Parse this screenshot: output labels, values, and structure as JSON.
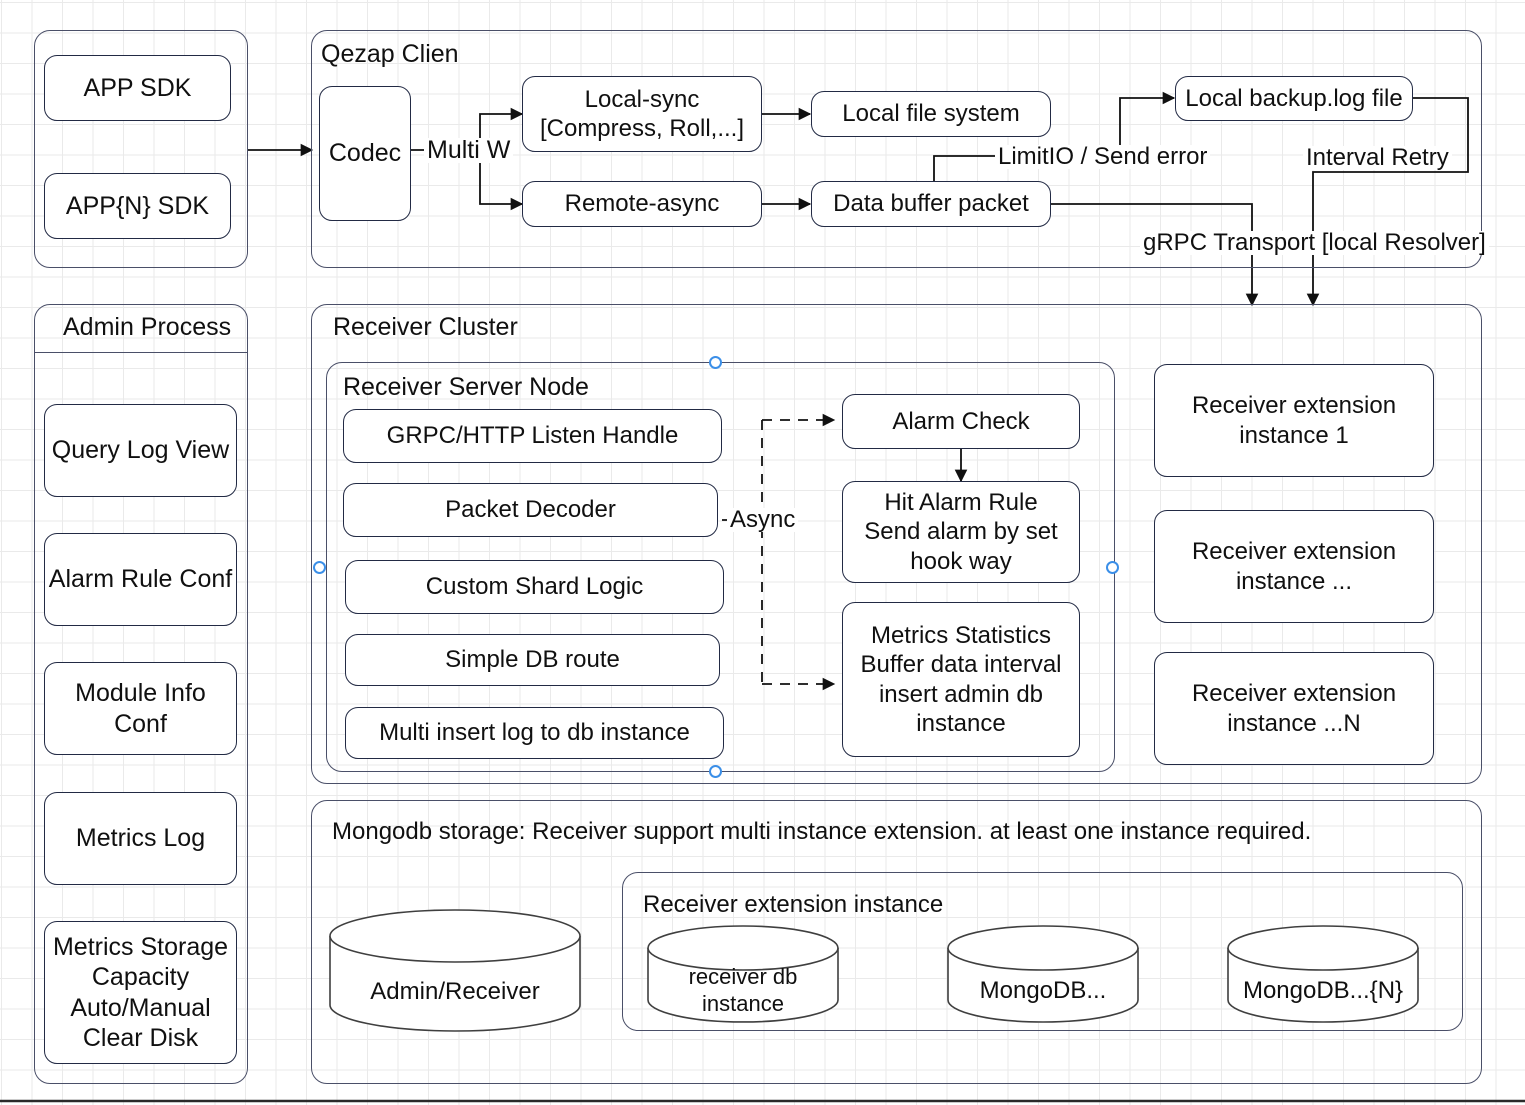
{
  "diagram": {
    "title_visible": false,
    "accent_handle_color": "#3b8fe8",
    "border_color": "#222a44",
    "group_border_color": "#4a4f68"
  },
  "app_group": {
    "items": [
      {
        "label": "APP SDK"
      },
      {
        "label": "APP{N} SDK"
      }
    ]
  },
  "admin_process": {
    "title": "Admin Process",
    "items": [
      {
        "label": "Query Log View"
      },
      {
        "label": "Alarm Rule Conf"
      },
      {
        "label": "Module Info\nConf"
      },
      {
        "label": "Metrics Log"
      },
      {
        "label": "Metrics Storage\nCapacity\nAuto/Manual\nClear Disk"
      }
    ]
  },
  "qezap_client": {
    "title": "Qezap Clien",
    "codec": "Codec",
    "multi_w_label": "Multi W",
    "local_sync": "Local-sync\n[Compress, Roll,...]",
    "remote_async": "Remote-async",
    "local_file_system": "Local file system",
    "data_buffer_packet": "Data buffer packet",
    "local_backup_log": "Local backup.log file",
    "limitio_label": "LimitIO / Send error",
    "interval_retry_label": "Interval Retry",
    "grpc_transport_label": "gRPC Transport [local Resolver]"
  },
  "receiver_cluster": {
    "title": "Receiver Cluster",
    "server_node": {
      "title": "Receiver Server Node",
      "items": [
        {
          "label": "GRPC/HTTP Listen Handle"
        },
        {
          "label": "Packet Decoder"
        },
        {
          "label": "Custom Shard Logic"
        },
        {
          "label": "Simple DB route"
        },
        {
          "label": "Multi insert log to db instance"
        }
      ]
    },
    "async_label": "Async",
    "alarm_check": "Alarm Check",
    "hit_alarm_rule": "Hit Alarm Rule\nSend alarm by set\nhook way",
    "metrics_statistics": "Metrics Statistics\nBuffer data interval\ninsert admin db\ninstance",
    "extensions": [
      {
        "label": "Receiver extension\ninstance 1"
      },
      {
        "label": "Receiver extension\ninstance ..."
      },
      {
        "label": "Receiver extension\ninstance ...N"
      }
    ]
  },
  "storage": {
    "title": "Mongodb storage: Receiver support multi instance extension. at least one instance required.",
    "admin_receiver_db": "Admin/Receiver",
    "extension_group_title": "Receiver extension instance",
    "dbs": [
      {
        "label": "receiver db\ninstance"
      },
      {
        "label": "MongoDB..."
      },
      {
        "label": "MongoDB...{N}"
      }
    ]
  }
}
